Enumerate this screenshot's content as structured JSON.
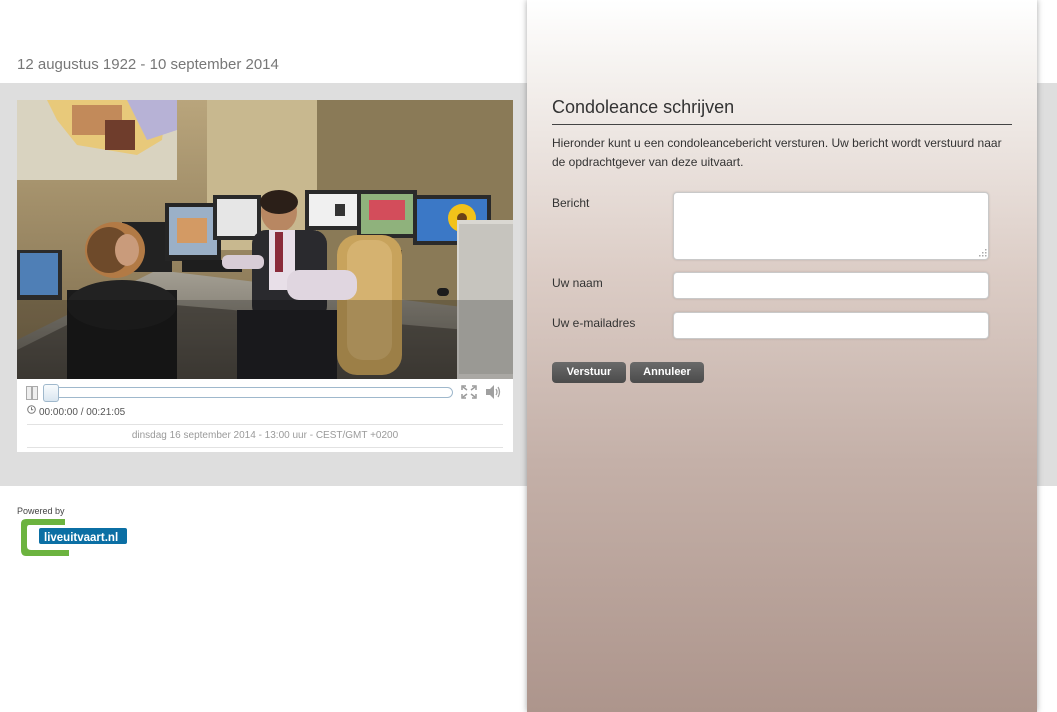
{
  "header": {
    "dates": "12 augustus 1922 - 10 september 2014"
  },
  "player": {
    "current_time": "00:00:00",
    "duration": "00:21:05",
    "time_display": "00:00:00 / 00:21:05",
    "progress": 0.0,
    "schedule": "dinsdag 16 september 2014 - 13:00 uur - CEST/GMT +0200",
    "icons": [
      "pause-icon",
      "fullscreen-icon",
      "volume-icon",
      "clock-icon"
    ]
  },
  "footer": {
    "powered_by": "Powered by",
    "logo_text": "liveuitvaart.nl",
    "logo_colors": {
      "green": "#6cb33f",
      "blue": "#0b6fa4"
    }
  },
  "condolence": {
    "title": "Condoleance schrijven",
    "description": "Hieronder kunt u een condoleancebericht versturen. Uw bericht wordt verstuurd naar de opdrachtgever van deze uitvaart.",
    "fields": {
      "message_label": "Bericht",
      "message_value": "",
      "name_label": "Uw naam",
      "name_value": "",
      "email_label": "Uw e-mailadres",
      "email_value": ""
    },
    "submit_label": "Verstuur",
    "cancel_label": "Annuleer"
  },
  "colors": {
    "band": "#dedede",
    "button": "#555555",
    "panel_bottom": "#ad958c"
  }
}
